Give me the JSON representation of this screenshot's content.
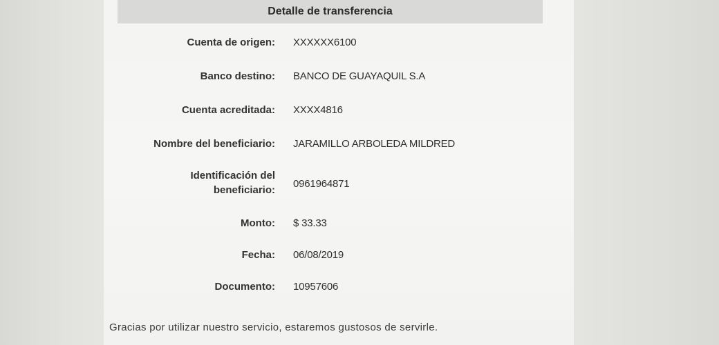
{
  "header": {
    "title": "Detalle de transferencia"
  },
  "fields": [
    {
      "label": "Cuenta de origen:",
      "value": "XXXXXX6100"
    },
    {
      "label": "Banco destino:",
      "value": "BANCO DE GUAYAQUIL S.A"
    },
    {
      "label": "Cuenta acreditada:",
      "value": "XXXX4816"
    },
    {
      "label": "Nombre del beneficiario:",
      "value": "JARAMILLO ARBOLEDA MILDRED"
    },
    {
      "label_line1": "Identificación del",
      "label_line2": "beneficiario:",
      "value": "0961964871"
    },
    {
      "label": "Monto:",
      "value": "$ 33.33"
    },
    {
      "label": "Fecha:",
      "value": "06/08/2019"
    },
    {
      "label": "Documento:",
      "value": "10957606"
    }
  ],
  "footer": {
    "message": "Gracias por utilizar nuestro servicio, estaremos gustosos de servirle."
  }
}
